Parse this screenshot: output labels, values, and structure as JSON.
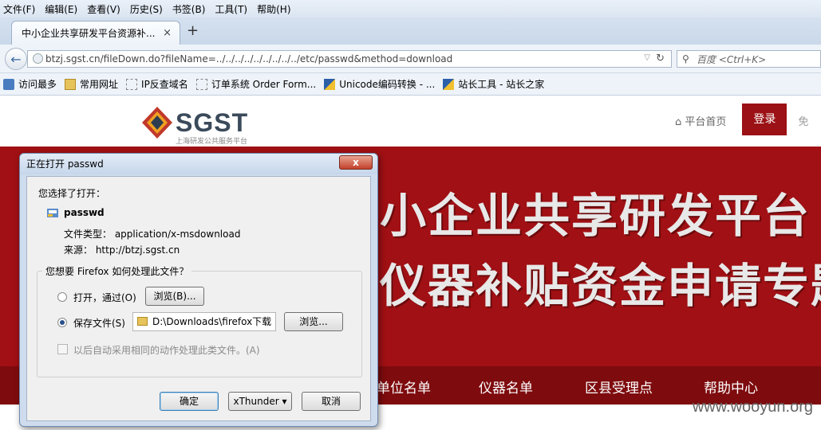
{
  "menubar": {
    "items": [
      "文件(F)",
      "编辑(E)",
      "查看(V)",
      "历史(S)",
      "书签(B)",
      "工具(T)",
      "帮助(H)"
    ]
  },
  "tab": {
    "title": "中小企业共享研发平台资源补...",
    "close": "×",
    "new_tab": "+"
  },
  "address": {
    "url": "btzj.sgst.cn/fileDown.do?fileName=../../../../../../../../../etc/passwd&method=download"
  },
  "search": {
    "placeholder": "百度 <Ctrl+K>"
  },
  "bookmarks": {
    "items": [
      "访问最多",
      "常用网址",
      "IP反查域名",
      "订单系统 Order Form...",
      "Unicode编码转换 - ...",
      "站长工具 - 站长之家"
    ]
  },
  "site": {
    "logo_name": "SGST",
    "logo_sub": "上海研发公共服务平台",
    "home_link": "平台首页",
    "login": "登录",
    "free": "免",
    "banner_line1": "小企业共享研发平台",
    "banner_line2": "仪器补贴资金申请专题",
    "menu": [
      "单位名单",
      "仪器名单",
      "区县受理点",
      "帮助中心"
    ],
    "watermark": "www.wooyun.org"
  },
  "dialog": {
    "title": "正在打开 passwd",
    "close": "x",
    "you_chose": "您选择了打开：",
    "filename": "passwd",
    "file_type": "文件类型：  application/x-msdownload",
    "source": "来源：  http://btzj.sgst.cn",
    "question": "您想要 Firefox 如何处理此文件？",
    "open_with": "打开，通过(O)",
    "browse1": "浏览(B)...",
    "save_file": "保存文件(S)",
    "save_path": "D:\\Downloads\\firefox下载",
    "browse2": "浏览...",
    "auto": "以后自动采用相同的动作处理此类文件。(A)",
    "ok": "确定",
    "xthunder": "xThunder ▾",
    "cancel": "取消"
  }
}
